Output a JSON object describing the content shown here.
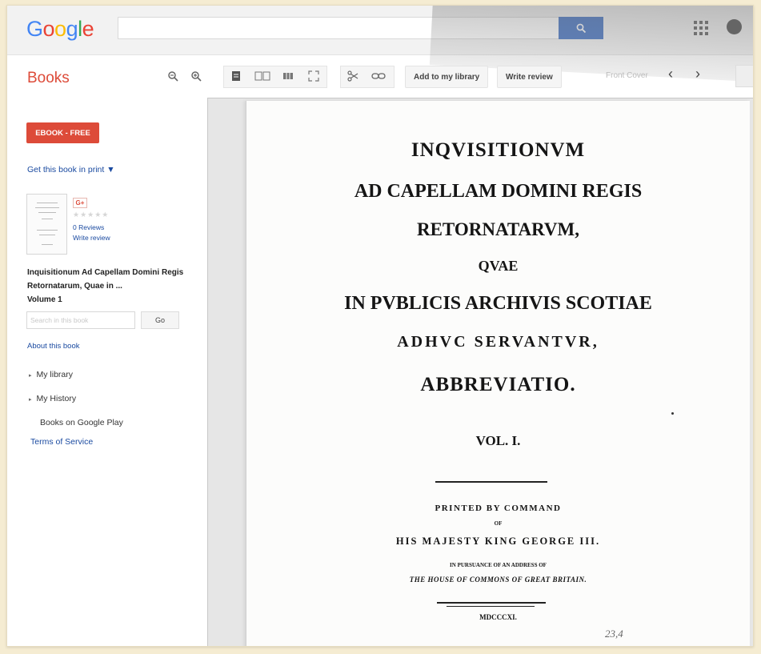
{
  "header": {
    "logo": [
      "G",
      "o",
      "o",
      "g",
      "l",
      "e"
    ],
    "logo_colors": [
      "#4285f4",
      "#ea4335",
      "#fbbc05",
      "#4285f4",
      "#34a853",
      "#ea4335"
    ],
    "search_placeholder": "",
    "search_icon": "magnifier-icon",
    "apps_icon": "grid-icon",
    "account_icon": "account-circle-icon"
  },
  "toolbar": {
    "section_title": "Books",
    "zoom_out_icon": "zoom-out-icon",
    "zoom_in_icon": "zoom-in-icon",
    "view_icons": [
      "single-page-icon",
      "two-page-icon",
      "thumbnail-view-icon",
      "fullscreen-icon"
    ],
    "clip_icon": "scissors-icon",
    "link_icon": "link-icon",
    "add_library_label": "Add to my library",
    "write_review_label": "Write review",
    "front_cover_label": "Front Cover",
    "prev_label": "‹",
    "next_label": "›"
  },
  "sidebar": {
    "ebook_label": "EBOOK - FREE",
    "print_link": "Get this book in print ▼",
    "gplus_label": "G+",
    "stars": "★★★★★",
    "reviews_label": "0 Reviews",
    "write_review_label": "Write review",
    "book_title": "Inquisitionum Ad Capellam Domini Regis Retornatarum, Quae in ...",
    "volume": "Volume 1",
    "search_placeholder": "Search in this book",
    "go_label": "Go",
    "about_link": "About this book",
    "nav": [
      "My library",
      "My History"
    ],
    "play_link": "Books on Google Play",
    "terms_link": "Terms of Service"
  },
  "page": {
    "lines": [
      "INQVISITIONVM",
      "AD CAPELLAM DOMINI REGIS",
      "RETORNATARVM,",
      "QVAE",
      "IN PVBLICIS ARCHIVIS SCOTIAE",
      "ADHVC SERVANTVR,",
      "ABBREVIATIO.",
      "VOL. I.",
      "PRINTED BY COMMAND",
      "OF",
      "HIS MAJESTY KING GEORGE III.",
      "IN PURSUANCE OF AN ADDRESS OF",
      "THE HOUSE OF COMMONS OF GREAT BRITAIN.",
      "MDCCCXI."
    ],
    "handnote": "23,4"
  }
}
